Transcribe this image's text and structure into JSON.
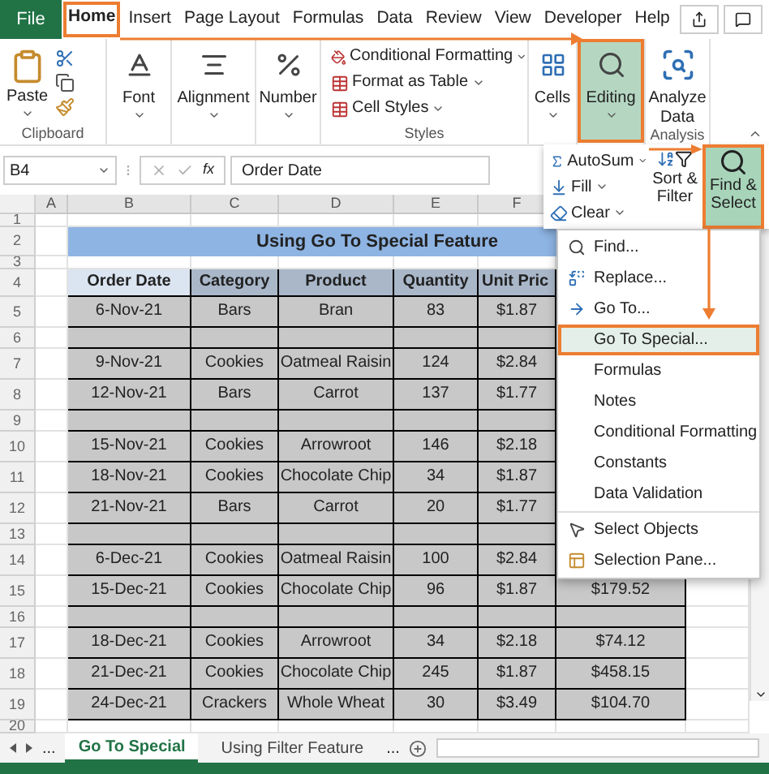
{
  "ribbon_tabs": [
    {
      "label": "File",
      "kind": "file",
      "selected": false,
      "annotated": false
    },
    {
      "label": "Home",
      "kind": "tab",
      "selected": true,
      "annotated": true
    },
    {
      "label": "Insert",
      "kind": "tab",
      "selected": false,
      "annotated": false
    },
    {
      "label": "Page Layout",
      "kind": "tab",
      "selected": false,
      "annotated": false
    },
    {
      "label": "Formulas",
      "kind": "tab",
      "selected": false,
      "annotated": false
    },
    {
      "label": "Data",
      "kind": "tab",
      "selected": false,
      "annotated": false
    },
    {
      "label": "Review",
      "kind": "tab",
      "selected": false,
      "annotated": false
    },
    {
      "label": "View",
      "kind": "tab",
      "selected": false,
      "annotated": false
    },
    {
      "label": "Developer",
      "kind": "tab",
      "selected": false,
      "annotated": false
    },
    {
      "label": "Help",
      "kind": "tab",
      "selected": false,
      "annotated": false
    }
  ],
  "ribbon_groups": [
    {
      "kind": "clipboard",
      "label": "Clipboard",
      "button": "Paste"
    },
    {
      "kind": "font",
      "button": "Font"
    },
    {
      "kind": "alignment",
      "button": "Alignment"
    },
    {
      "kind": "number",
      "button": "Number"
    },
    {
      "kind": "styles",
      "label": "Styles",
      "items": [
        "Conditional Formatting",
        "Format as Table",
        "Cell Styles"
      ]
    },
    {
      "kind": "cells",
      "button": "Cells"
    },
    {
      "kind": "editing",
      "button": "Editing",
      "annotated": true
    },
    {
      "kind": "analyze",
      "label": "Analysis",
      "button": "Analyze Data"
    }
  ],
  "formula_bar": {
    "name_box": "B4",
    "fx": "fx",
    "value": "Order Date"
  },
  "column_headers": [
    "A",
    "B",
    "C",
    "D",
    "E",
    "F"
  ],
  "rows": [
    {
      "kind": "empty",
      "number": "1"
    },
    {
      "kind": "title",
      "number": "2",
      "title": "Using Go To Special Feature"
    },
    {
      "kind": "empty",
      "number": "3"
    },
    {
      "kind": "header",
      "number": "4",
      "cells": [
        "Order Date",
        "Category",
        "Product",
        "Quantity",
        "Unit Pric"
      ]
    },
    {
      "kind": "data",
      "number": "5",
      "cells": [
        "6-Nov-21",
        "Bars",
        "Bran",
        "83",
        "$1.87"
      ]
    },
    {
      "kind": "blank",
      "number": "6"
    },
    {
      "kind": "data",
      "number": "7",
      "cells": [
        "9-Nov-21",
        "Cookies",
        "Oatmeal Raisin",
        "124",
        "$2.84"
      ]
    },
    {
      "kind": "data",
      "number": "8",
      "cells": [
        "12-Nov-21",
        "Bars",
        "Carrot",
        "137",
        "$1.77"
      ]
    },
    {
      "kind": "blank",
      "number": "9"
    },
    {
      "kind": "data",
      "number": "10",
      "cells": [
        "15-Nov-21",
        "Cookies",
        "Arrowroot",
        "146",
        "$2.18"
      ]
    },
    {
      "kind": "data",
      "number": "11",
      "cells": [
        "18-Nov-21",
        "Cookies",
        "Chocolate Chip",
        "34",
        "$1.87"
      ]
    },
    {
      "kind": "data",
      "number": "12",
      "cells": [
        "21-Nov-21",
        "Bars",
        "Carrot",
        "20",
        "$1.77"
      ]
    },
    {
      "kind": "blank",
      "number": "13"
    },
    {
      "kind": "data",
      "number": "14",
      "cells": [
        "6-Dec-21",
        "Cookies",
        "Oatmeal Raisin",
        "100",
        "$2.84"
      ]
    },
    {
      "kind": "data",
      "number": "15",
      "cells": [
        "15-Dec-21",
        "Cookies",
        "Chocolate Chip",
        "96",
        "$1.87"
      ],
      "total": "$179.52"
    },
    {
      "kind": "blank",
      "number": "16"
    },
    {
      "kind": "data",
      "number": "17",
      "cells": [
        "18-Dec-21",
        "Cookies",
        "Arrowroot",
        "34",
        "$2.18"
      ],
      "total": "$74.12"
    },
    {
      "kind": "data",
      "number": "18",
      "cells": [
        "21-Dec-21",
        "Cookies",
        "Chocolate Chip",
        "245",
        "$1.87"
      ],
      "total": "$458.15"
    },
    {
      "kind": "data",
      "number": "19",
      "cells": [
        "24-Dec-21",
        "Crackers",
        "Whole Wheat",
        "30",
        "$3.49"
      ],
      "total": "$104.70"
    },
    {
      "kind": "empty",
      "number": "20"
    }
  ],
  "editing_panel": {
    "items": [
      {
        "label": "AutoSum",
        "kind": "autosum"
      },
      {
        "label": "Fill",
        "kind": "fill"
      },
      {
        "label": "Clear",
        "kind": "clear"
      }
    ],
    "sort_filter": "Sort & Filter",
    "find_select": {
      "label": "Find & Select",
      "annotated": true
    }
  },
  "find_menu": {
    "sections": [
      [
        {
          "label": "Find...",
          "kind": "find",
          "selected": false,
          "annotated": false
        },
        {
          "label": "Replace...",
          "kind": "replace",
          "selected": false,
          "annotated": false
        },
        {
          "label": "Go To...",
          "kind": "goto",
          "selected": false,
          "annotated": false
        },
        {
          "label": "Go To Special...",
          "kind": "plain",
          "selected": true,
          "annotated": true
        },
        {
          "label": "Formulas",
          "kind": "plain",
          "selected": false,
          "annotated": false
        },
        {
          "label": "Notes",
          "kind": "plain",
          "selected": false,
          "annotated": false
        },
        {
          "label": "Conditional Formatting",
          "kind": "plain",
          "selected": false,
          "annotated": false
        },
        {
          "label": "Constants",
          "kind": "plain",
          "selected": false,
          "annotated": false
        },
        {
          "label": "Data Validation",
          "kind": "plain",
          "selected": false,
          "annotated": false
        }
      ],
      [
        {
          "label": "Select Objects",
          "kind": "select",
          "selected": false,
          "annotated": false
        },
        {
          "label": "Selection Pane...",
          "kind": "pane",
          "selected": false,
          "annotated": false
        }
      ]
    ]
  },
  "sheet_tabs": {
    "more_left": "...",
    "tabs": [
      {
        "label": "Go To Special",
        "selected": true
      },
      {
        "label": "Using Filter Feature",
        "selected": false
      }
    ],
    "more_right": "..."
  }
}
